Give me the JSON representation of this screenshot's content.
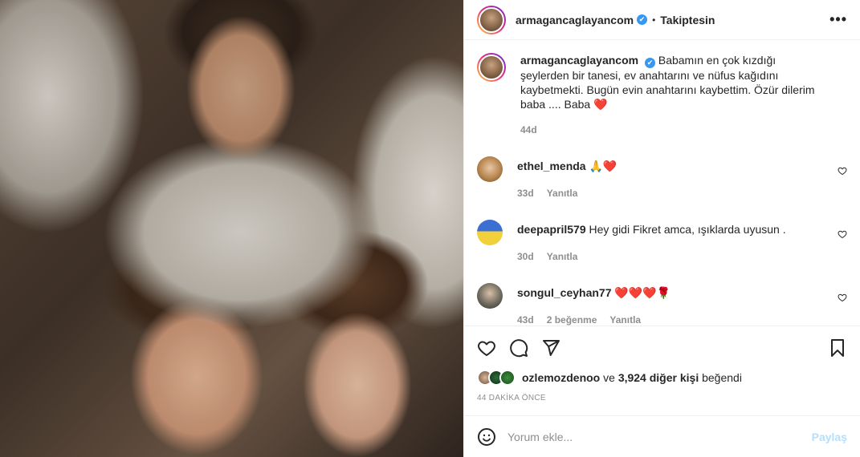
{
  "post": {
    "username": "armagancaglayancom",
    "follow_status": "Takiptesin",
    "dot": "•",
    "verified_icon": "✔",
    "more_icon": "•••"
  },
  "caption": {
    "username": "armagancaglayancom",
    "text": "Babamın en çok kızdığı şeylerden bir tanesi, ev anahtarını ve nüfus kağıdını kaybetmekti. Bugün evin anahtarını kaybettim. Özür dilerim baba .... Baba ❤️",
    "age": "44d"
  },
  "comments": [
    {
      "username": "ethel_menda",
      "text": "🙏❤️",
      "age": "33d",
      "likes": "",
      "reply": "Yanıtla"
    },
    {
      "username": "deepapril579",
      "text": "Hey gidi Fikret amca, ışıklarda uyusun .",
      "age": "30d",
      "likes": "",
      "reply": "Yanıtla"
    },
    {
      "username": "songul_ceyhan77",
      "text": "❤️❤️❤️🌹",
      "age": "43d",
      "likes": "2 beğenme",
      "reply": "Yanıtla"
    }
  ],
  "likes": {
    "first_liker": "ozlemozdenoo",
    "connector": "ve",
    "others": "3,924 diğer kişi",
    "suffix": "beğendi"
  },
  "time_ago": "44 DAKİKA ÖNCE",
  "add_comment": {
    "placeholder": "Yorum ekle...",
    "share_label": "Paylaş"
  },
  "colors": {
    "accent_blue": "#0095f6",
    "share_disabled": "#b2dffc",
    "heart_red": "#ed4956",
    "verified": "#3897f0"
  }
}
